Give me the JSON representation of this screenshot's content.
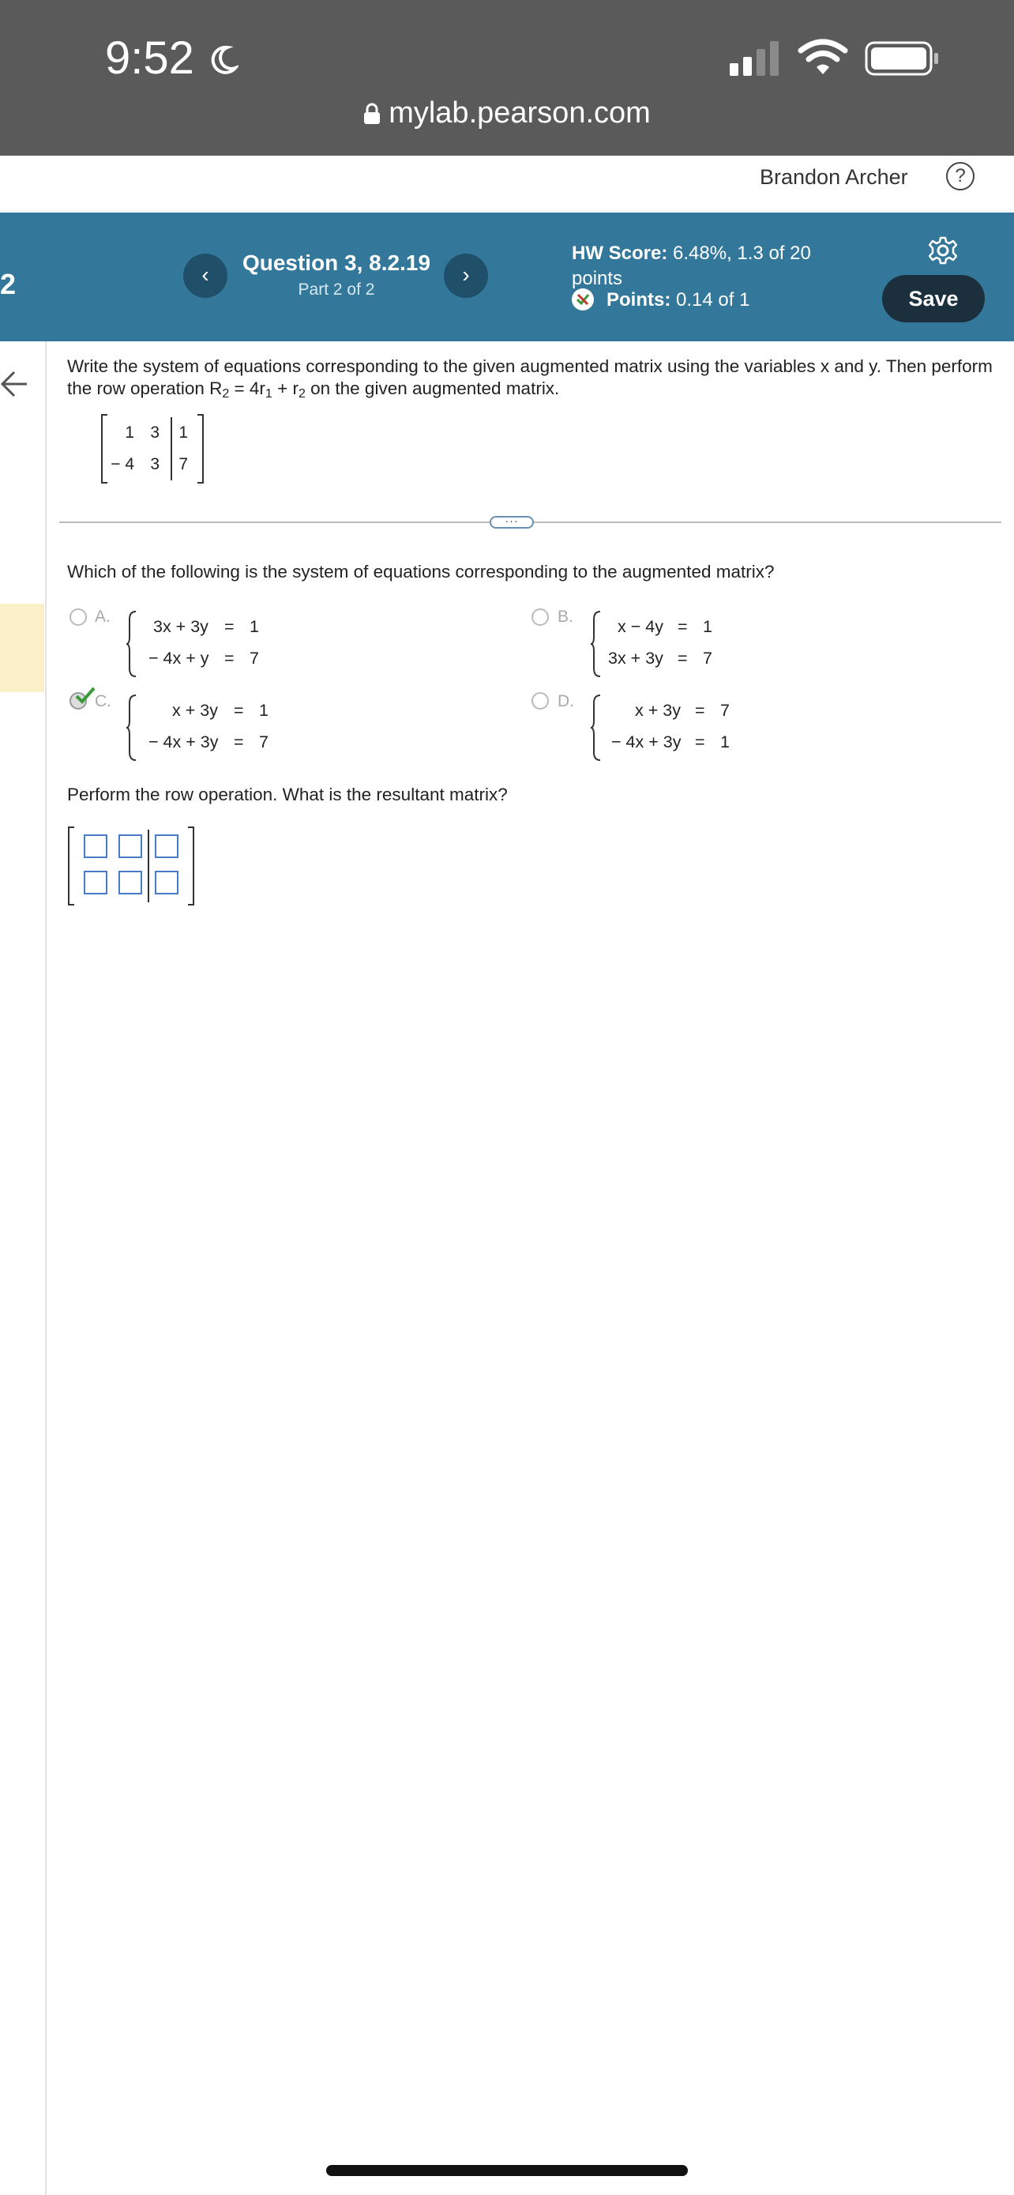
{
  "status_bar": {
    "time": "9:52",
    "url": "mylab.pearson.com"
  },
  "user": {
    "name": "Brandon Archer"
  },
  "header": {
    "question_number_fragment": "2",
    "question_title": "Question 3, 8.2.19",
    "question_part": "Part 2 of 2",
    "hw_score_label": "HW Score:",
    "hw_score_value": "6.48%, 1.3 of 20",
    "hw_score_value_cont": "points",
    "points_label": "Points:",
    "points_value": "0.14 of 1",
    "save_label": "Save",
    "prev_glyph": "‹",
    "next_glyph": "›",
    "help_glyph": "?"
  },
  "problem": {
    "instruction_line1": "Write the system of equations corresponding to the given augmented matrix using the variables x and y. Then perform",
    "instruction_line2_a": "the row operation R",
    "instruction_line2_sub1": "2",
    "instruction_line2_b": " = 4r",
    "instruction_line2_sub2": "1",
    "instruction_line2_c": " + r",
    "instruction_line2_sub3": "2",
    "instruction_line2_d": " on the given augmented matrix.",
    "matrix": [
      [
        "1",
        "3",
        "1"
      ],
      [
        "− 4",
        "3",
        "7"
      ]
    ]
  },
  "question1": {
    "prompt": "Which of the following is the system of equations corresponding to the augmented matrix?",
    "options": [
      {
        "label": "A.",
        "eq1": "3x + 3y",
        "rhs1": "1",
        "eq2": "− 4x + y",
        "rhs2": "7"
      },
      {
        "label": "B.",
        "eq1": "x − 4y",
        "rhs1": "1",
        "eq2": "3x + 3y",
        "rhs2": "7"
      },
      {
        "label": "C.",
        "eq1": "x + 3y",
        "rhs1": "1",
        "eq2": "− 4x + 3y",
        "rhs2": "7"
      },
      {
        "label": "D.",
        "eq1": "x + 3y",
        "rhs1": "7",
        "eq2": "− 4x + 3y",
        "rhs2": "1"
      }
    ],
    "equals": "=",
    "selected": "C.",
    "selected_state": "correct"
  },
  "question2": {
    "prompt": "Perform the row operation. What is the resultant matrix?"
  },
  "colors": {
    "header_blue": "#33789a",
    "status_gray": "#5a5a5a",
    "save_dark": "#1b2f3d",
    "check_green": "#3a9a3a",
    "input_blue": "#4a7bc9"
  }
}
